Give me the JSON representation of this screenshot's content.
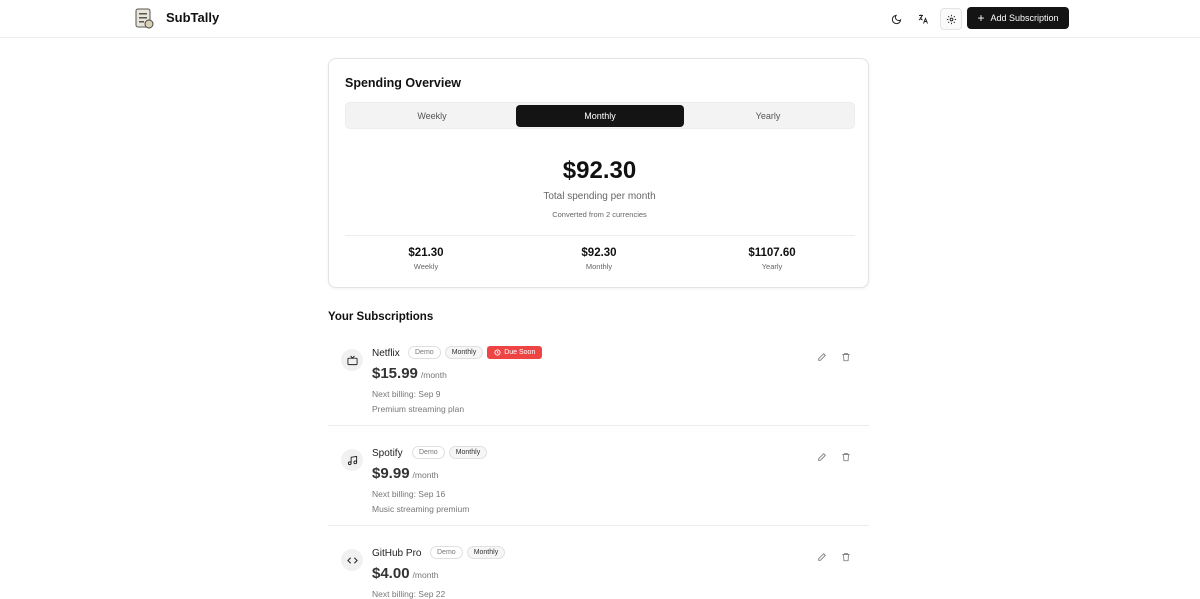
{
  "app": {
    "title": "SubTally",
    "add_button": "Add Subscription"
  },
  "header_icons": [
    "moon-icon",
    "translate-icon",
    "gear-icon"
  ],
  "overview": {
    "title": "Spending Overview",
    "tabs": [
      "Weekly",
      "Monthly",
      "Yearly"
    ],
    "selected_tab": "Monthly",
    "amount": "$92.30",
    "subtitle": "Total spending per month",
    "converted": "Converted from 2 currencies",
    "stats": [
      {
        "value": "$21.30",
        "label": "Weekly"
      },
      {
        "value": "$92.30",
        "label": "Monthly"
      },
      {
        "value": "$1107.60",
        "label": "Yearly"
      }
    ]
  },
  "subscriptions": {
    "title": "Your Subscriptions",
    "items": [
      {
        "name": "Netflix",
        "demo": "Demo",
        "frequency": "Monthly",
        "due": "Due Soon",
        "price": "$15.99",
        "per": "/month",
        "next": "Next billing: Sep 9",
        "description": "Premium streaming plan",
        "icon": "tv-icon"
      },
      {
        "name": "Spotify",
        "demo": "Demo",
        "frequency": "Monthly",
        "price": "$9.99",
        "per": "/month",
        "next": "Next billing: Sep 16",
        "description": "Music streaming premium",
        "icon": "music-icon"
      },
      {
        "name": "GitHub Pro",
        "demo": "Demo",
        "frequency": "Monthly",
        "price": "$4.00",
        "per": "/month",
        "next": "Next billing: Sep 22",
        "description": "",
        "icon": "code-icon"
      }
    ]
  },
  "colors": {
    "accent": "#141414",
    "due": "#ef4444"
  }
}
